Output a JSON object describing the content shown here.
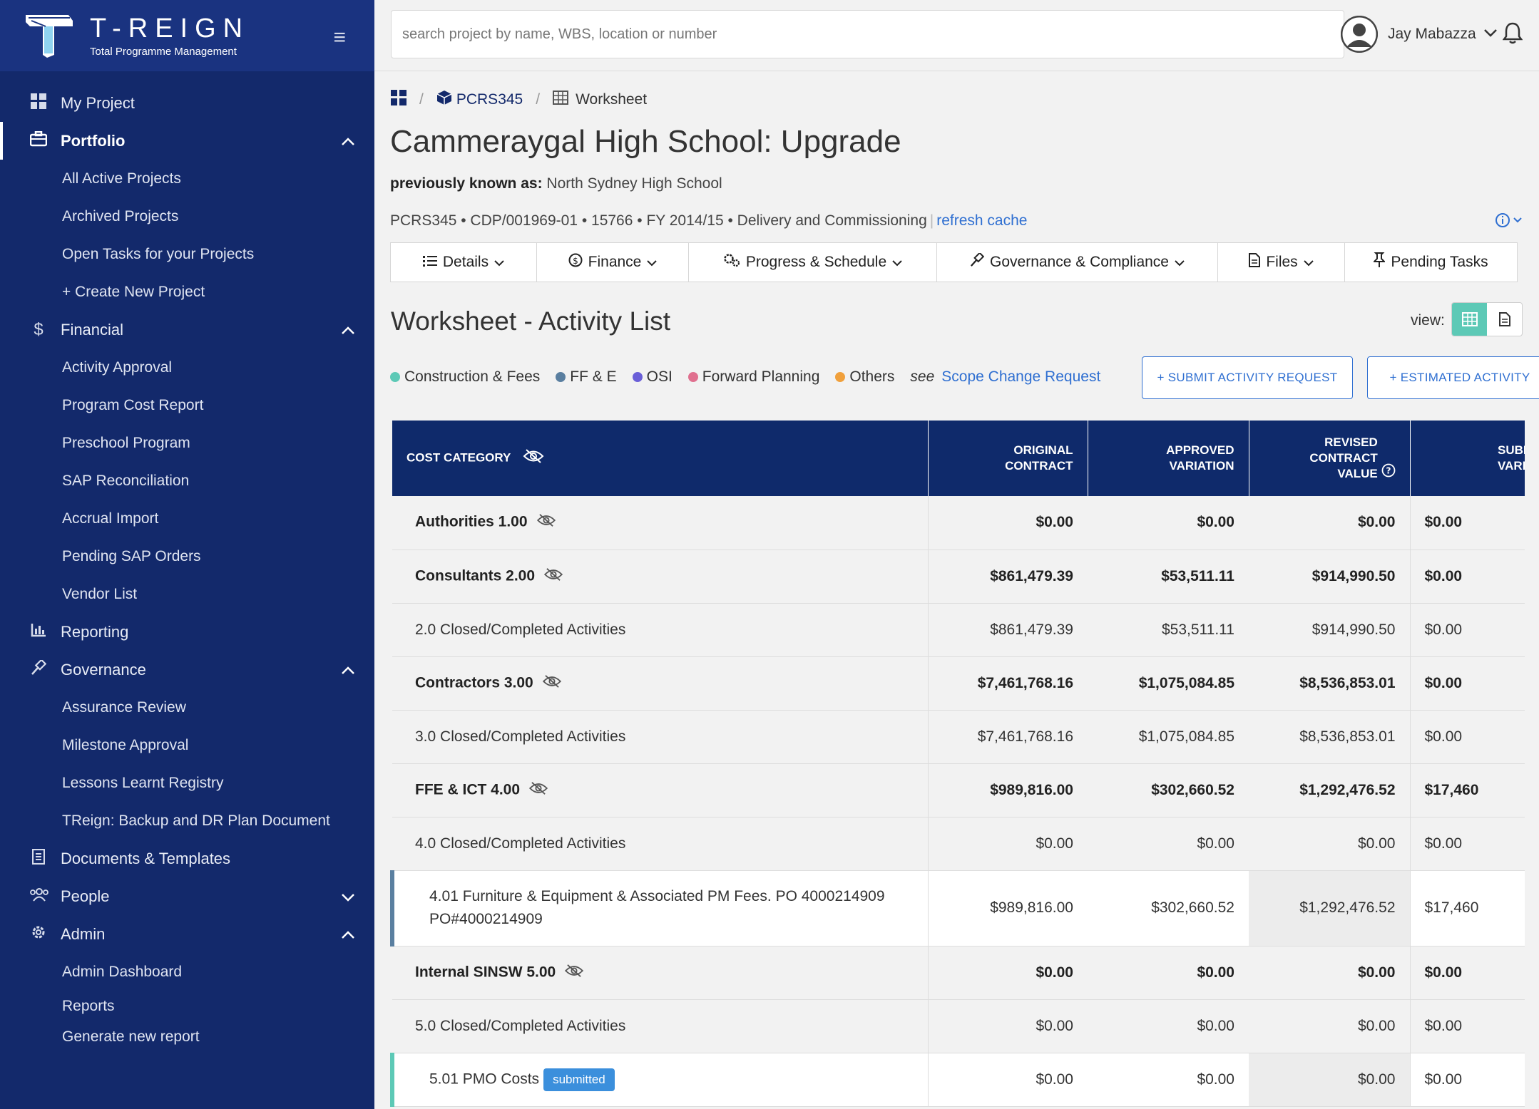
{
  "brand": {
    "name": "T-REIGN",
    "subtitle": "Total Programme Management"
  },
  "search": {
    "placeholder": "search project by name, WBS, location or number"
  },
  "user": {
    "name": "Jay Mabazza"
  },
  "sidebar": {
    "items": [
      {
        "label": "My Project",
        "icon": "dashboard-icon"
      },
      {
        "label": "Portfolio",
        "icon": "briefcase-icon"
      },
      {
        "label": "All Active Projects"
      },
      {
        "label": "Archived Projects"
      },
      {
        "label": "Open Tasks for your Projects"
      },
      {
        "label": "+ Create New Project"
      },
      {
        "label": "Financial",
        "icon": "dollar-icon"
      },
      {
        "label": "Activity Approval"
      },
      {
        "label": "Program Cost Report"
      },
      {
        "label": "Preschool Program"
      },
      {
        "label": "SAP Reconciliation"
      },
      {
        "label": "Accrual Import"
      },
      {
        "label": "Pending SAP Orders"
      },
      {
        "label": "Vendor List"
      },
      {
        "label": "Reporting",
        "icon": "bar-chart-icon"
      },
      {
        "label": "Governance",
        "icon": "gavel-icon"
      },
      {
        "label": "Assurance Review"
      },
      {
        "label": "Milestone Approval"
      },
      {
        "label": "Lessons Learnt Registry"
      },
      {
        "label": "TReign: Backup and DR Plan Document"
      },
      {
        "label": "Documents & Templates",
        "icon": "document-icon"
      },
      {
        "label": "People",
        "icon": "people-icon"
      },
      {
        "label": "Admin",
        "icon": "gear-icon"
      },
      {
        "label": "Admin Dashboard"
      },
      {
        "label": "Reports"
      },
      {
        "label": "Generate new report"
      }
    ]
  },
  "breadcrumb": {
    "project": "PCRS345",
    "page": "Worksheet"
  },
  "project": {
    "title": "Cammeraygal High School: Upgrade",
    "aka_label": "previously known as:",
    "aka_value": "North Sydney High School",
    "meta": "PCRS345 • CDP/001969-01 • 15766 • FY 2014/15 • Delivery and Commissioning",
    "refresh": "refresh cache"
  },
  "tabs": [
    {
      "label": "Details"
    },
    {
      "label": "Finance"
    },
    {
      "label": "Progress & Schedule"
    },
    {
      "label": "Governance & Compliance"
    },
    {
      "label": "Files"
    },
    {
      "label": "Pending Tasks"
    }
  ],
  "worksheet": {
    "title": "Worksheet - Activity List",
    "view_label": "view:",
    "legend": [
      {
        "label": "Construction & Fees",
        "color": "#5dc9b6"
      },
      {
        "label": "FF & E",
        "color": "#5a7fa0"
      },
      {
        "label": "OSI",
        "color": "#6a5fd8"
      },
      {
        "label": "Forward Planning",
        "color": "#e0708f"
      },
      {
        "label": "Others",
        "color": "#f0a03c"
      }
    ],
    "see_label": "see",
    "scope_link": "Scope Change Request",
    "submit_btn": "+ SUBMIT ACTIVITY REQUEST",
    "estimated_btn": "+ ESTIMATED ACTIVITY"
  },
  "table": {
    "headers": {
      "category": "COST CATEGORY",
      "original": "ORIGINAL CONTRACT",
      "approved": "APPROVED VARIATION",
      "revised": "REVISED CONTRACT VALUE",
      "submitted": "SUBMITTED VARIATION"
    },
    "rows": [
      {
        "category": "Authorities 1.00",
        "original": "$0.00",
        "approved": "$0.00",
        "revised": "$0.00",
        "submitted": "$0.00"
      },
      {
        "category": "Consultants 2.00",
        "original": "$861,479.39",
        "approved": "$53,511.11",
        "revised": "$914,990.50",
        "submitted": "$0.00"
      },
      {
        "category": "2.0 Closed/Completed Activities",
        "original": "$861,479.39",
        "approved": "$53,511.11",
        "revised": "$914,990.50",
        "submitted": "$0.00"
      },
      {
        "category": "Contractors 3.00",
        "original": "$7,461,768.16",
        "approved": "$1,075,084.85",
        "revised": "$8,536,853.01",
        "submitted": "$0.00"
      },
      {
        "category": "3.0 Closed/Completed Activities",
        "original": "$7,461,768.16",
        "approved": "$1,075,084.85",
        "revised": "$8,536,853.01",
        "submitted": "$0.00"
      },
      {
        "category": "FFE & ICT 4.00",
        "original": "$989,816.00",
        "approved": "$302,660.52",
        "revised": "$1,292,476.52",
        "submitted": "$17,460"
      },
      {
        "category": "4.0 Closed/Completed Activities",
        "original": "$0.00",
        "approved": "$0.00",
        "revised": "$0.00",
        "submitted": "$0.00"
      },
      {
        "category": "4.01 Furniture & Equipment & Associated PM Fees. PO 4000214909 PO#4000214909",
        "original": "$989,816.00",
        "approved": "$302,660.52",
        "revised": "$1,292,476.52",
        "submitted": "$17,460"
      },
      {
        "category": "Internal SINSW 5.00",
        "original": "$0.00",
        "approved": "$0.00",
        "revised": "$0.00",
        "submitted": "$0.00"
      },
      {
        "category": "5.0 Closed/Completed Activities",
        "original": "$0.00",
        "approved": "$0.00",
        "revised": "$0.00",
        "submitted": "$0.00"
      },
      {
        "category": "5.01 PMO Costs",
        "badge": "submitted",
        "original": "$0.00",
        "approved": "$0.00",
        "revised": "$0.00",
        "submitted": "$0.00"
      }
    ]
  }
}
